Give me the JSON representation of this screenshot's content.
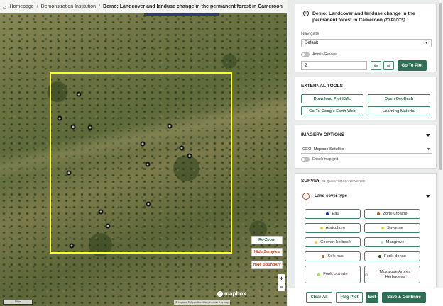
{
  "breadcrumb": {
    "home": "Homepage",
    "institution": "Demonstration Institution",
    "current": "Demo: Landcover and landuse change in the permanent forest in Cameroon"
  },
  "map": {
    "buttons": {
      "rezoom": "Re-Zoom",
      "hide_samples": "Hide Samples",
      "hide_boundary": "Hide Boundary"
    },
    "zoom_in": "+",
    "zoom_out": "−",
    "logo": "mapbox",
    "attribution": "© Mapbox © OpenStreetMap Improve this map",
    "scale": "50 m",
    "colors": {
      "plot_boundary": "#ffff2a"
    }
  },
  "project": {
    "title": "Demo: Landcover and landuse change in the permanent forest in Cameroon",
    "plots": "(70 PLOTS)",
    "navigate_label": "Navigate",
    "navigate_value": "Default",
    "admin_review": "Admin Review",
    "plot_number": "2",
    "prev_icon": "arrow-left",
    "next_icon": "arrow-right",
    "goto_label": "Go To Plot"
  },
  "tools": {
    "title": "EXTERNAL TOOLS",
    "download_kml": "Download Plot KML",
    "open_geodash": "Open GeoDash",
    "google_earth": "Go To Google Earth Web",
    "learning": "Learning Material"
  },
  "imagery": {
    "title": "IMAGERY OPTIONS",
    "source": "CEO: Mapbox Satellite",
    "grid_label": "Enable map grid"
  },
  "survey": {
    "title": "SURVEY",
    "answered": "0/1 QUESTIONS ANSWERED",
    "question": "Land cover type",
    "answers": [
      {
        "label": "Eau",
        "color": "#1a2fb0"
      },
      {
        "label": "Zone urbaine",
        "color": "#c4531c"
      },
      {
        "label": "Agriculture",
        "color": "#e3d21a"
      },
      {
        "label": "Savanne",
        "color": "#c8e024"
      },
      {
        "label": "Couvert herbacé",
        "color": "#f0c84a"
      },
      {
        "label": "Mangrove",
        "color": "#a8dde6"
      },
      {
        "label": "Sols nus",
        "color": "#8a6a3a"
      },
      {
        "label": "Forêt dense",
        "color": "#2d4a1e"
      },
      {
        "label": "Forêt ouverte",
        "color": "#9bd94a"
      },
      {
        "label": "Mosaique Arbres Herbacees",
        "color": "#eeeeee"
      }
    ]
  },
  "footer": {
    "clear_all": "Clear All",
    "flag_plot": "Flag Plot",
    "exit": "Exit",
    "save": "Save & Continue"
  }
}
